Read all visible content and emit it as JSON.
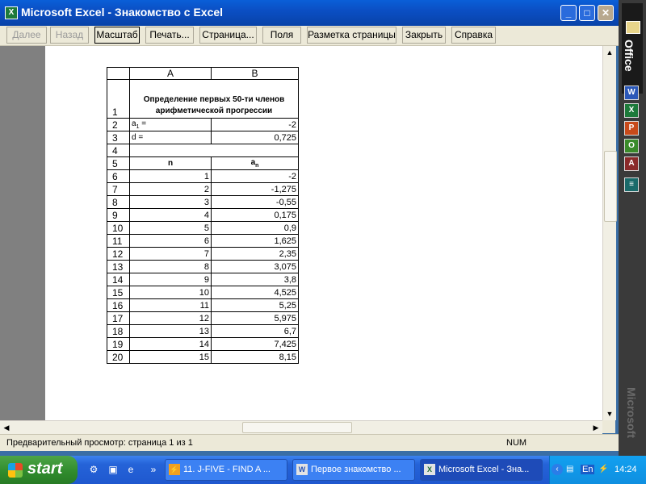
{
  "window": {
    "title": "Microsoft Excel - Знакомство с Excel",
    "app_icon": "excel-icon"
  },
  "toolbar": {
    "buttons": [
      {
        "label": "Далее",
        "state": "disabled"
      },
      {
        "label": "Назад",
        "state": "disabled"
      },
      {
        "label": "Масштаб",
        "state": "active"
      },
      {
        "label": "Печать...",
        "state": "normal"
      },
      {
        "label": "Страница...",
        "state": "normal"
      },
      {
        "label": "Поля",
        "state": "normal"
      },
      {
        "label": "Разметка страницы",
        "state": "normal"
      },
      {
        "label": "Закрыть",
        "state": "normal"
      },
      {
        "label": "Справка",
        "state": "normal"
      }
    ]
  },
  "sheet": {
    "columns": [
      "A",
      "B"
    ],
    "title_row": {
      "row": "1",
      "text": "Определение первых 50-ти членов арифметической прогрессии"
    },
    "param_rows": [
      {
        "row": "2",
        "label": "a1 =",
        "label_main": "a",
        "label_sub": "1",
        "label_rest": " =",
        "value": "-2"
      },
      {
        "row": "3",
        "label": "d =",
        "value": "0,725"
      }
    ],
    "empty_row": "4",
    "header_row": {
      "row": "5",
      "col_a": "n",
      "col_b_main": "a",
      "col_b_sub": "n"
    },
    "data_rows": [
      {
        "row": "6",
        "n": "1",
        "a": "-2"
      },
      {
        "row": "7",
        "n": "2",
        "a": "-1,275"
      },
      {
        "row": "8",
        "n": "3",
        "a": "-0,55"
      },
      {
        "row": "9",
        "n": "4",
        "a": "0,175"
      },
      {
        "row": "10",
        "n": "5",
        "a": "0,9"
      },
      {
        "row": "11",
        "n": "6",
        "a": "1,625"
      },
      {
        "row": "12",
        "n": "7",
        "a": "2,35"
      },
      {
        "row": "13",
        "n": "8",
        "a": "3,075"
      },
      {
        "row": "14",
        "n": "9",
        "a": "3,8"
      },
      {
        "row": "15",
        "n": "10",
        "a": "4,525"
      },
      {
        "row": "16",
        "n": "11",
        "a": "5,25"
      },
      {
        "row": "17",
        "n": "12",
        "a": "5,975"
      },
      {
        "row": "18",
        "n": "13",
        "a": "6,7"
      },
      {
        "row": "19",
        "n": "14",
        "a": "7,425"
      },
      {
        "row": "20",
        "n": "15",
        "a": "8,15"
      }
    ]
  },
  "statusbar": {
    "text": "Предварительный просмотр: страница 1 из 1",
    "indicator": "NUM"
  },
  "office_bar": {
    "label": "Office",
    "watermark": "Microsoft",
    "icons": [
      "word-icon",
      "excel-icon",
      "powerpoint-icon",
      "outlook-icon",
      "access-icon",
      "bookshelf-icon"
    ]
  },
  "taskbar": {
    "start_label": "start",
    "items": [
      {
        "label": "11. J-FIVE - FIND A ...",
        "icon": "winamp-icon",
        "active": false
      },
      {
        "label": "Первое знакомство ...",
        "icon": "word-icon",
        "active": false
      },
      {
        "label": "Microsoft Excel - Зна...",
        "icon": "excel-icon",
        "active": true
      }
    ],
    "tray": {
      "lang": "En",
      "clock": "14:24"
    }
  }
}
